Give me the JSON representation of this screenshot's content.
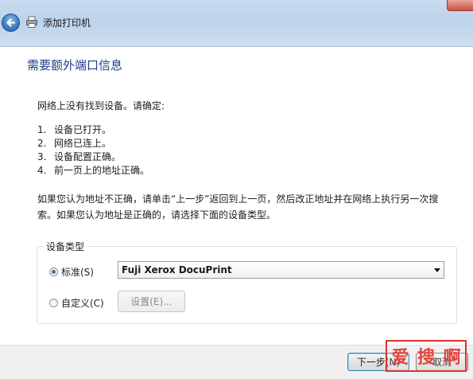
{
  "window": {
    "title": "添加打印机",
    "back_icon": "back-arrow-icon",
    "title_icon": "printer-icon"
  },
  "page": {
    "heading": "需要额外端口信息",
    "intro": "网络上没有找到设备。请确定:",
    "checklist": [
      {
        "num": "1.",
        "text": "设备已打开。"
      },
      {
        "num": "2.",
        "text": "网络已连上。"
      },
      {
        "num": "3.",
        "text": "设备配置正确。"
      },
      {
        "num": "4.",
        "text": "前一页上的地址正确。"
      }
    ],
    "paragraph": "如果您认为地址不正确，请单击“上一步”返回到上一页，然后改正地址并在网络上执行另一次搜索。如果您认为地址是正确的，请选择下面的设备类型。"
  },
  "device_type": {
    "group_label": "设备类型",
    "standard_label": "标准(S)",
    "standard_selected": true,
    "selected_device": "Fuji Xerox DocuPrint",
    "custom_label": "自定义(C)",
    "custom_selected": false,
    "settings_button": "设置(E)..."
  },
  "footer": {
    "next_button": "下一步(N)",
    "cancel_button": "取消"
  },
  "watermark": {
    "chars": [
      "爱",
      "搜",
      "啊"
    ]
  },
  "colors": {
    "heading": "#1f3f8c",
    "watermark": "#e2453c"
  }
}
